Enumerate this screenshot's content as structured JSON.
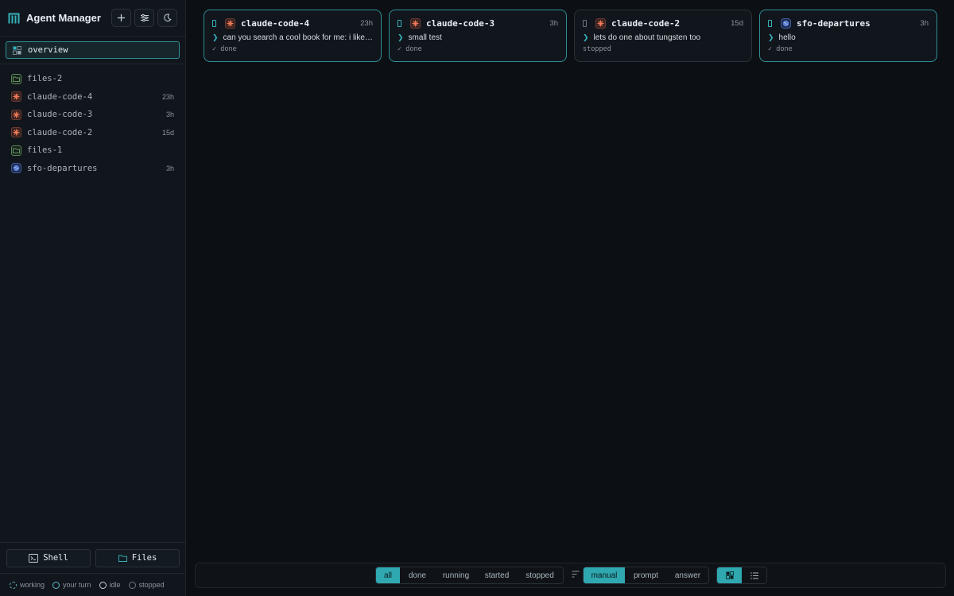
{
  "app": {
    "title": "Agent Manager"
  },
  "sidebar": {
    "overview_label": "overview",
    "items": [
      {
        "label": "files-2",
        "age": "",
        "icon": "folder-icon"
      },
      {
        "label": "claude-code-4",
        "age": "23h",
        "icon": "claude-icon"
      },
      {
        "label": "claude-code-3",
        "age": "3h",
        "icon": "claude-icon"
      },
      {
        "label": "claude-code-2",
        "age": "15d",
        "icon": "claude-icon"
      },
      {
        "label": "files-1",
        "age": "",
        "icon": "folder-icon"
      },
      {
        "label": "sfo-departures",
        "age": "3h",
        "icon": "globe-icon"
      }
    ],
    "shell_label": "Shell",
    "files_label": "Files",
    "legend": [
      "working",
      "your turn",
      "idle",
      "stopped"
    ]
  },
  "cards": [
    {
      "name": "claude-code-4",
      "age": "23h",
      "prompt": "can you search a cool book for me: i like…",
      "status": "✓ done",
      "icon": "claude-icon"
    },
    {
      "name": "claude-code-3",
      "age": "3h",
      "prompt": "small test",
      "status": "✓ done",
      "icon": "claude-icon"
    },
    {
      "name": "claude-code-2",
      "age": "15d",
      "prompt": "lets do one about tungsten too",
      "status": "stopped",
      "icon": "claude-icon"
    },
    {
      "name": "sfo-departures",
      "age": "3h",
      "prompt": "hello",
      "status": "✓ done",
      "icon": "globe-icon"
    }
  ],
  "toolbar": {
    "filters": [
      "all",
      "done",
      "running",
      "started",
      "stopped"
    ],
    "active_filter": "all",
    "sorts": [
      "manual",
      "prompt",
      "answer"
    ],
    "active_sort": "manual",
    "views": [
      "grid-view-icon",
      "list-view-icon"
    ],
    "active_view": "grid-view-icon"
  },
  "colors": {
    "accent": "#2fa8b0",
    "background": "#0c0f13",
    "claude": "#e8704f"
  }
}
